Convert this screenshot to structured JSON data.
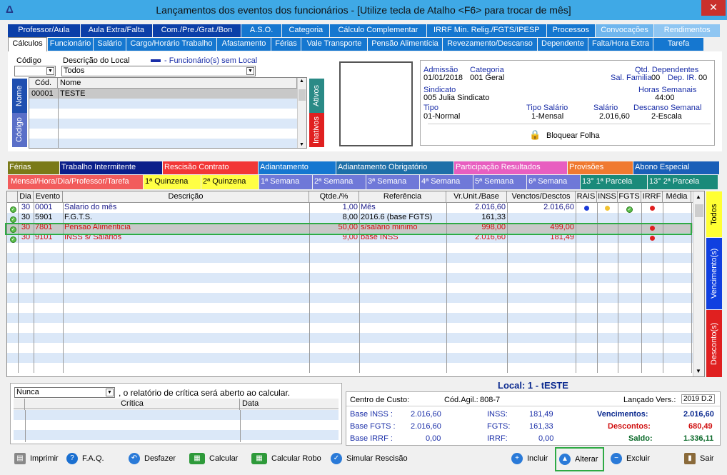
{
  "window": {
    "title": "Lançamentos dos eventos dos funcionários - [Utilize tecla de Atalho <F6> para trocar de mês]",
    "close": "✕"
  },
  "tabs_row1": [
    "Professor/Aula",
    "Aula Extra/Falta",
    "Com./Pre./Grat./Bon",
    "A.S.O.",
    "Categoria",
    "Cálculo Complementar",
    "IRRF Min. Relig./FGTS/IPESP",
    "Processos",
    "Convocações",
    "Rendimentos"
  ],
  "tabs_row2": [
    "Cálculos",
    "Funcionário",
    "Salário",
    "Cargo/Horário Trabalho",
    "Afastamento",
    "Férias",
    "Vale Transporte",
    "Pensão Alimentícia",
    "Revezamento/Descanso",
    "Dependente",
    "Falta/Hora Extra",
    "Tarefa"
  ],
  "filter": {
    "codigo_label": "Código",
    "descricao_label": "Descrição do Local",
    "descricao_value": "Todos",
    "legend": "- Funcionário(s) sem Local"
  },
  "emp_list": {
    "col_cod": "Cód.",
    "col_nome": "Nome",
    "rows": [
      {
        "cod": "00001",
        "nome": "TESTE"
      }
    ],
    "vtab_nome": "Nome",
    "vtab_codigo": "Código",
    "vtab_ativos": "Ativos",
    "vtab_inativos": "Inativos"
  },
  "info": {
    "admissao_label": "Admissão",
    "admissao": "01/01/2018",
    "categoria_label": "Categoria",
    "categoria": "001  Geral",
    "qtd_dep_label": "Qtd. Dependentes",
    "sal_familia_label": "Sal. Familia",
    "sal_familia": "00",
    "dep_ir_label": "Dep. IR.",
    "dep_ir": "00",
    "sindicato_label": "Sindicato",
    "sindicato": "005  Julia Sindicato",
    "horas_label": "Horas Semanais",
    "horas": "44:00",
    "tipo_label": "Tipo",
    "tipo": "01-Normal",
    "tipo_salario_label": "Tipo Salário",
    "tipo_salario": "1-Mensal",
    "salario_label": "Salário",
    "salario": "2.016,60",
    "descanso_label": "Descanso Semanal",
    "descanso": "2-Escala",
    "bloquear": "Bloquear Folha"
  },
  "tabs_row3": [
    "Férias",
    "Trabalho Intermitente",
    "Rescisão Contrato",
    "Adiantamento",
    "Adiantamento Obrigatório",
    "Participação Resultados",
    "Provisões",
    "Abono Especial"
  ],
  "tabs_row4": [
    "Mensal/Hora/Dia/Professor/Tarefa",
    "1ª Quinzena",
    "2ª Quinzena",
    "1ª Semana",
    "2ª Semana",
    "3ª Semana",
    "4ª Semana",
    "5ª Semana",
    "6ª Semana",
    "13°  1ª Parcela",
    "13°  2ª Parcela"
  ],
  "events": {
    "headers": [
      "Dia",
      "Evento",
      "Descrição",
      "Qtde./%",
      "Referência",
      "Vr.Unit./Base",
      "Venctos/Desctos",
      "RAIS",
      "INSS",
      "FGTS",
      "IRRF",
      "Média"
    ],
    "rows": [
      {
        "dia": "30",
        "evento": "0001",
        "descricao": "Salario do mês",
        "qtde": "1,00",
        "referencia": "Mês",
        "vr": "2.016,60",
        "vd": "2.016,60",
        "color": "#1a1a8a"
      },
      {
        "dia": "30",
        "evento": "5901",
        "descricao": "F.G.T.S.",
        "qtde": "8,00",
        "referencia": "2016.6 (base FGTS)",
        "vr": "161,33",
        "vd": "",
        "color": "#000000"
      },
      {
        "dia": "30",
        "evento": "7801",
        "descricao": "Pensao Alimenticia",
        "qtde": "50,00",
        "referencia": "s/salário minimo",
        "vr": "998,00",
        "vd": "499,00",
        "color": "#d01010"
      },
      {
        "dia": "30",
        "evento": "9101",
        "descricao": "INSS s/ Salarios",
        "qtde": "9,00",
        "referencia": "base INSS",
        "vr": "2.016,60",
        "vd": "181,49",
        "color": "#d01010"
      }
    ],
    "side_tabs": [
      "Todos",
      "Vencimento(s)",
      "Desconto(s)"
    ]
  },
  "critica": {
    "select": "Nunca",
    "text": ", o relatório de crítica será aberto ao calcular.",
    "col_critica": "Crítica",
    "col_data": "Data"
  },
  "summary": {
    "local": "Local: 1 - tESTE",
    "centro_label": "Centro de Custo:",
    "cod_agil_label": "Cód.Agil.:",
    "cod_agil": "808-7",
    "lancado_label": "Lançado Vers.:",
    "lancado": "2019 D.2",
    "base_inss_label": "Base INSS :",
    "base_inss": "2.016,60",
    "inss_label": "INSS:",
    "inss": "181,49",
    "venc_label": "Vencimentos:",
    "venc": "2.016,60",
    "base_fgts_label": "Base FGTS :",
    "base_fgts": "2.016,60",
    "fgts_label": "FGTS:",
    "fgts": "161,33",
    "desc_label": "Descontos:",
    "desc": "680,49",
    "base_irrf_label": "Base  IRRF :",
    "base_irrf": "0,00",
    "irrf_label": "IRRF:",
    "irrf": "0,00",
    "saldo_label": "Saldo:",
    "saldo": "1.336,11"
  },
  "toolbar": {
    "imprimir": "Imprimir",
    "faq": "F.A.Q.",
    "desfazer": "Desfazer",
    "calcular": "Calcular",
    "calcular_robo": "Calcular Robo",
    "simular": "Simular Rescisão",
    "incluir": "Incluir",
    "alterar": "Alterar",
    "excluir": "Excluir",
    "sair": "Sair"
  },
  "colors": {
    "title_bar": "#3fa9e6",
    "tab_blue": "#1577d0",
    "tab_navy": "#0b2a8f",
    "selected_row": "#2eaa44"
  }
}
